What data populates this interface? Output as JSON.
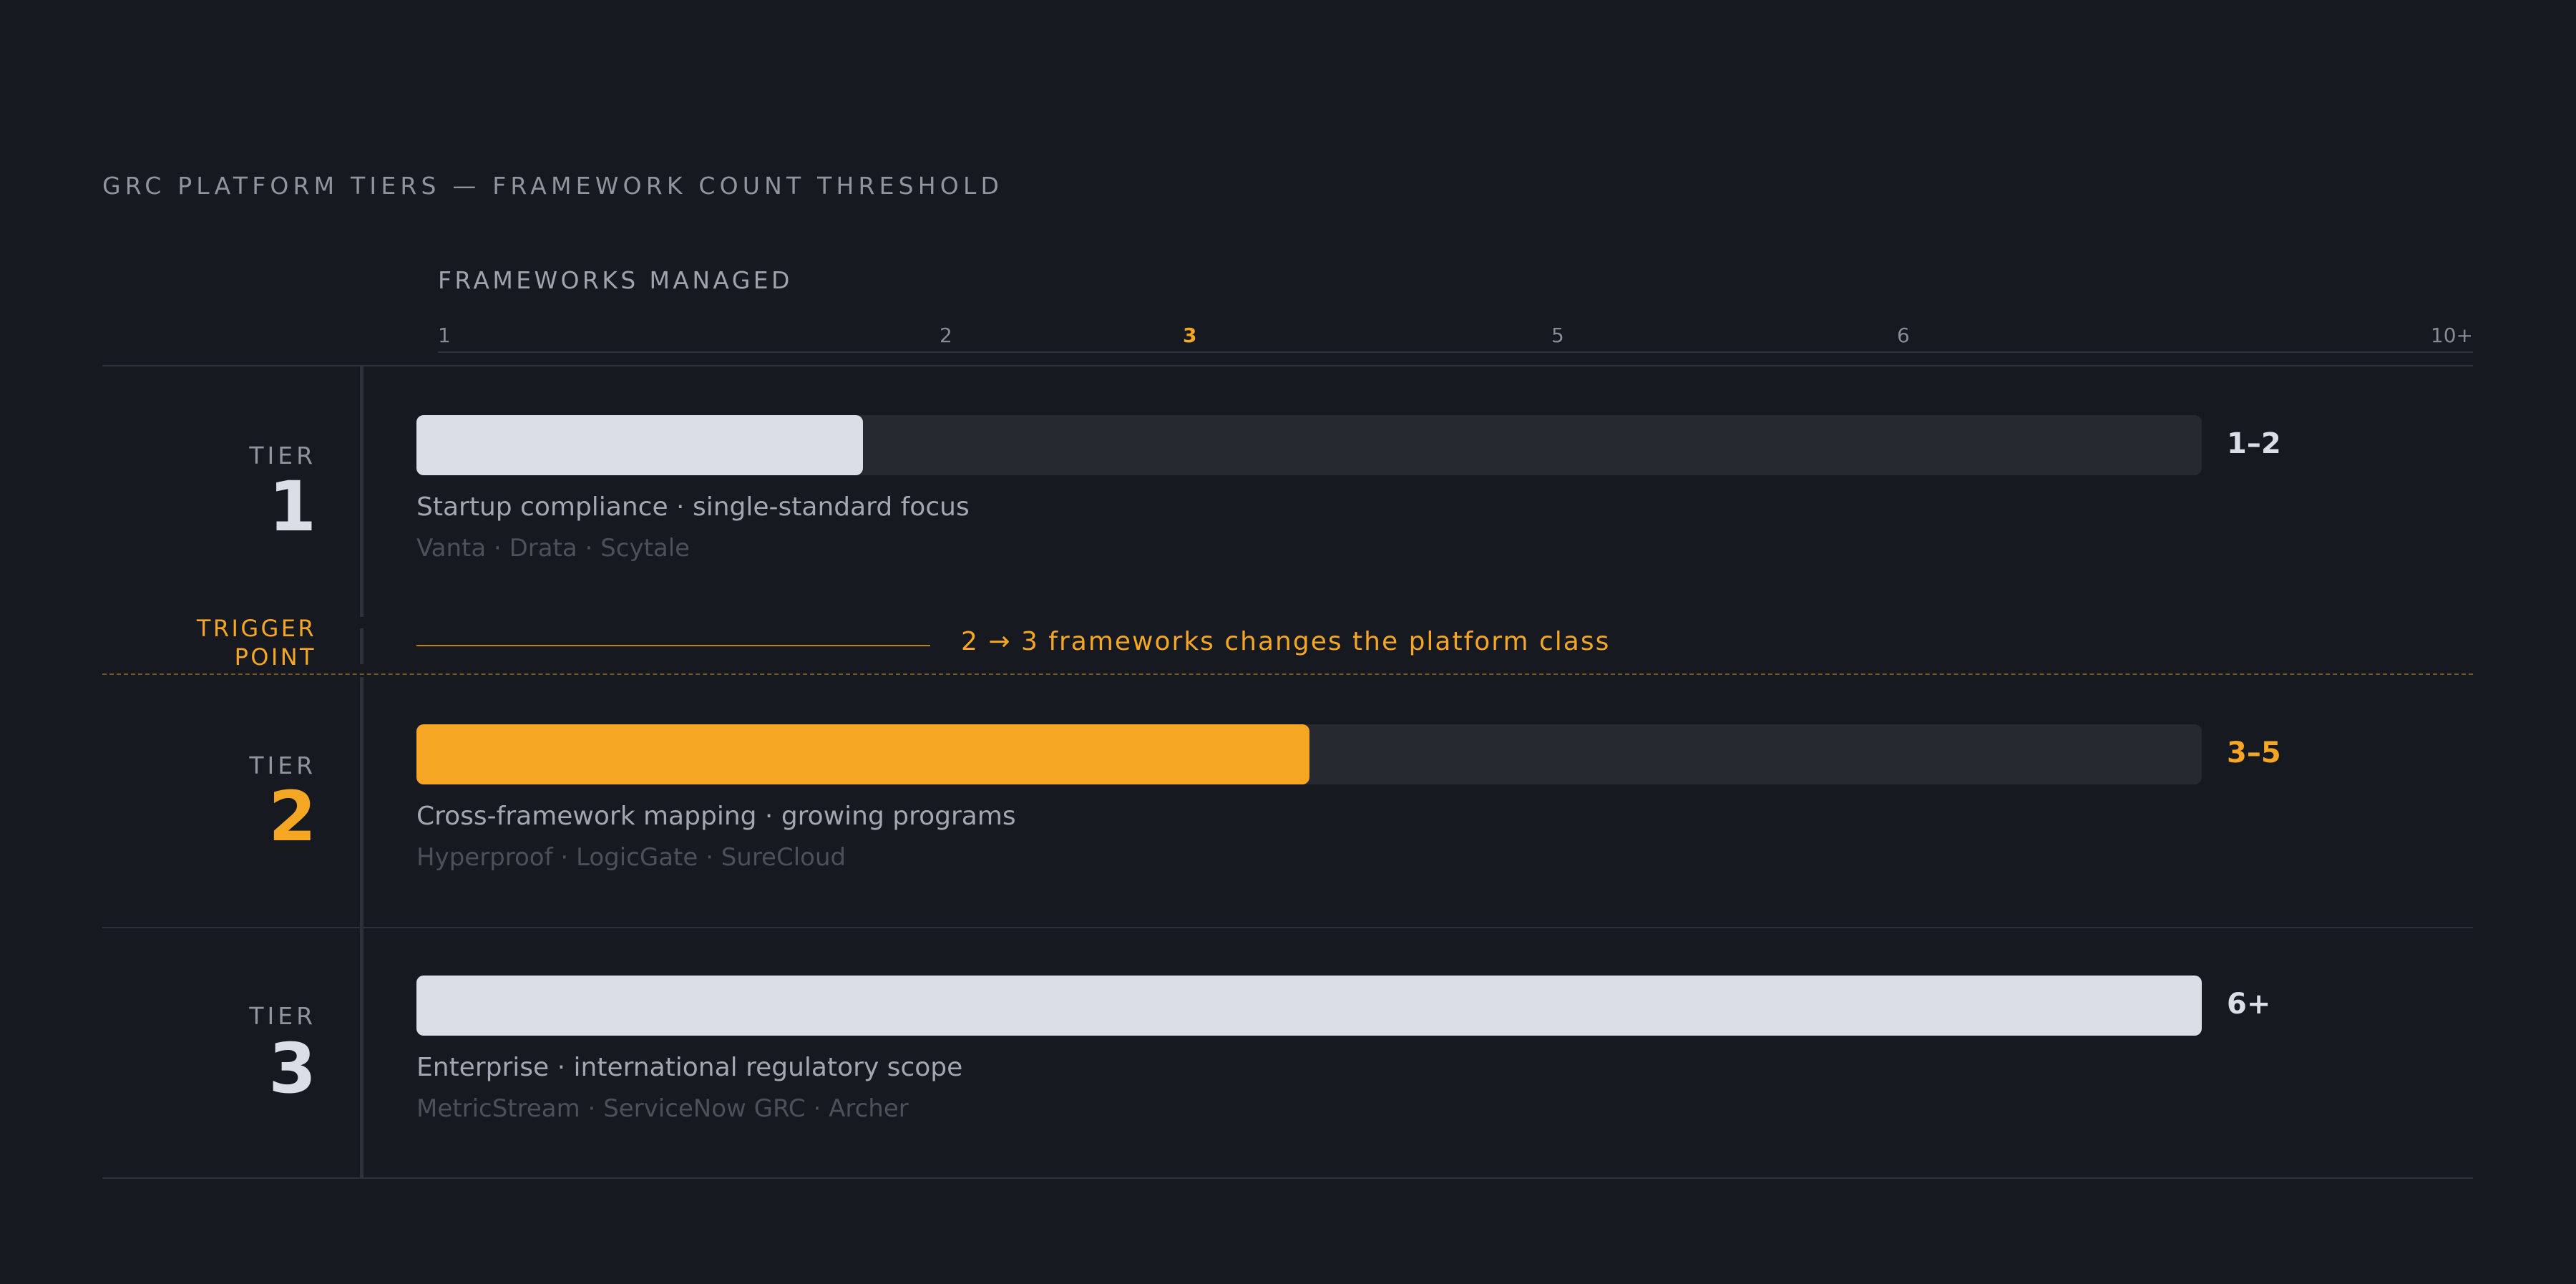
{
  "chart_data": {
    "type": "bar",
    "title": "GRC PLATFORM TIERS — FRAMEWORK COUNT THRESHOLD",
    "xlabel": "FRAMEWORKS MANAGED",
    "ylabel": "",
    "x_ticks": [
      "1",
      "2",
      "3",
      "5",
      "6",
      "10+"
    ],
    "highlight_tick": "3",
    "xlim": [
      1,
      10
    ],
    "grid": false,
    "categories": [
      "1",
      "2",
      "3"
    ],
    "tiers": [
      {
        "label": "TIER",
        "number": "1",
        "range": "1–2",
        "value": 0.25,
        "description": "Startup compliance · single-standard focus",
        "vendors": "Vanta · Drata · Scytale",
        "fill_color": "#dadee6",
        "number_color": "#dadee6"
      },
      {
        "label": "TIER",
        "number": "2",
        "range": "3–5",
        "value": 0.5,
        "description": "Cross-framework mapping · growing programs",
        "vendors": "Hyperproof · LogicGate · SureCloud",
        "fill_color": "#f5a623",
        "number_color": "#f5a623"
      },
      {
        "label": "TIER",
        "number": "3",
        "range": "6+",
        "value": 1.0,
        "description": "Enterprise · international regulatory scope",
        "vendors": "MetricStream · ServiceNow GRC · Archer",
        "fill_color": "#dadee6",
        "number_color": "#dadee6"
      }
    ],
    "trigger": {
      "label_line1": "TRIGGER",
      "label_line2": "POINT",
      "text": "2 → 3 frameworks changes the platform class",
      "color": "#f5a623"
    },
    "colors": {
      "background": "#161920",
      "track": "#262930",
      "accent": "#f5a623",
      "light": "#dadee6"
    }
  }
}
